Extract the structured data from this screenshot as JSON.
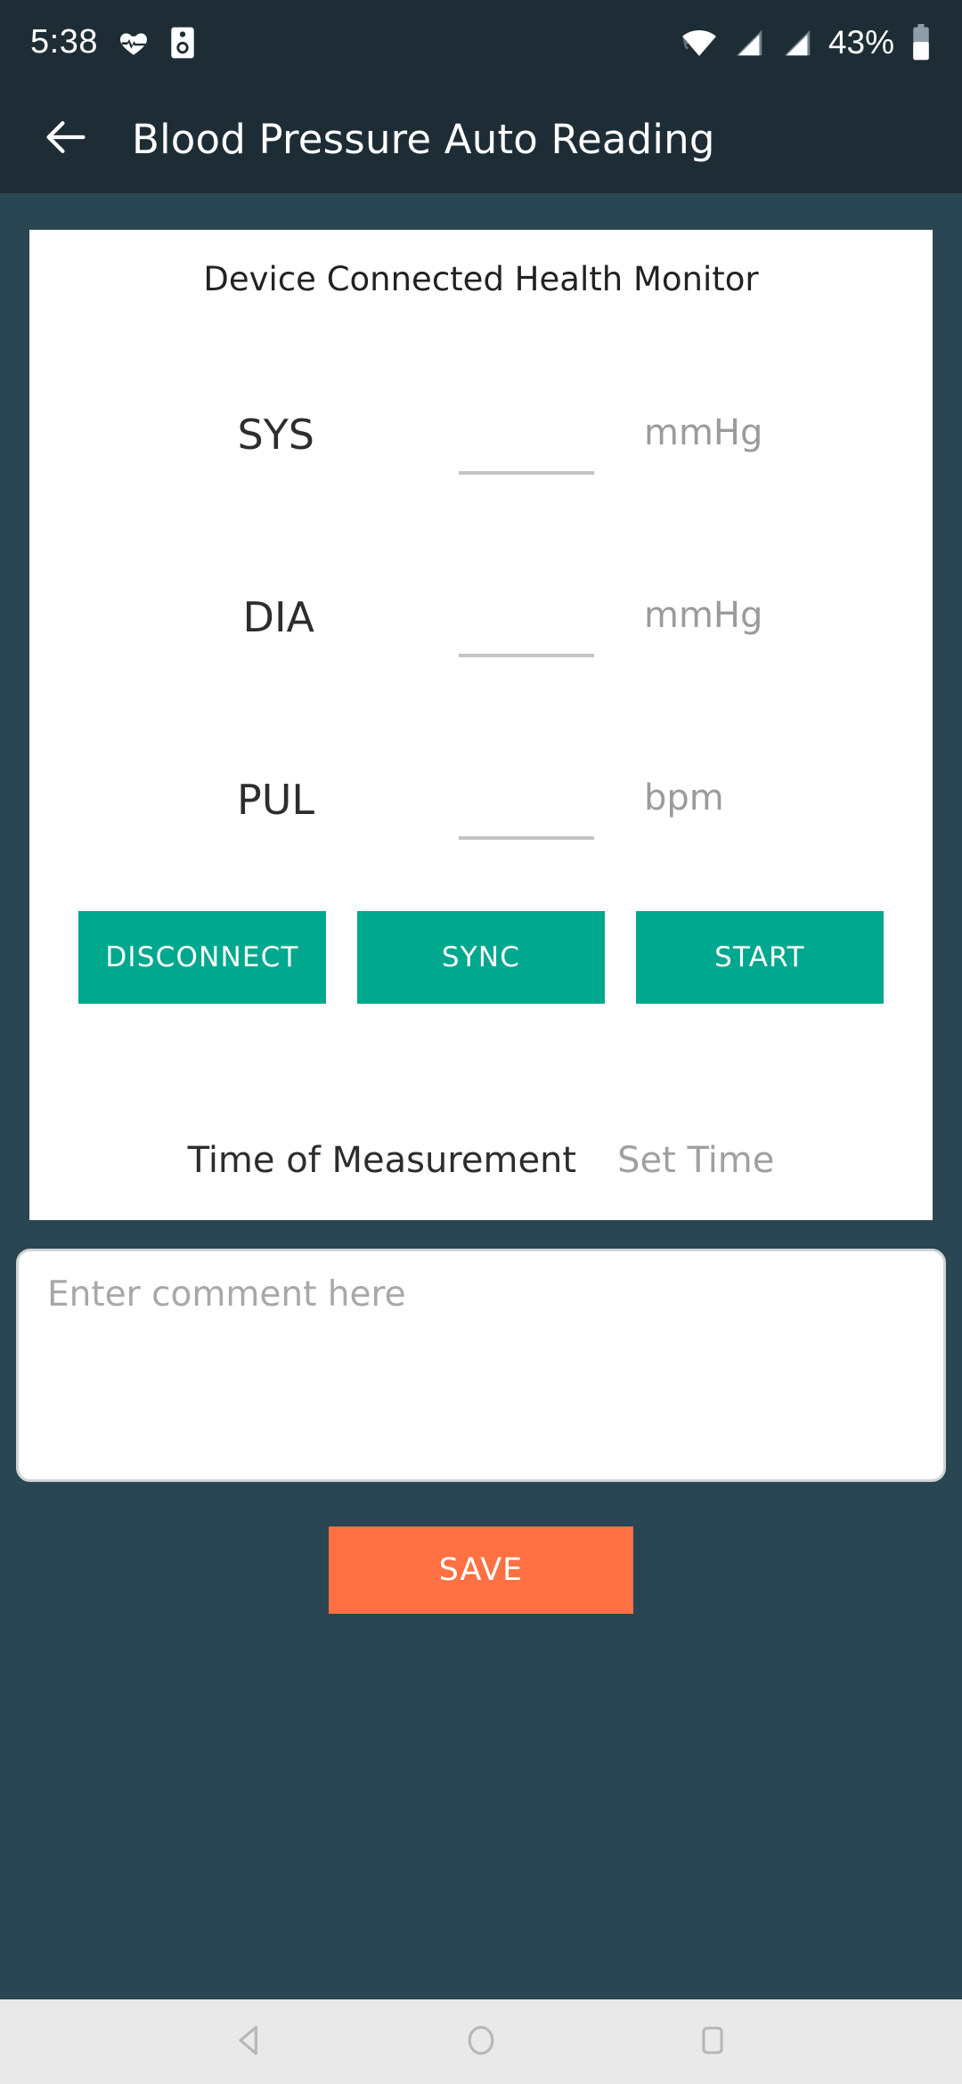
{
  "status_bar": {
    "clock": "5:38",
    "left_icons": [
      {
        "name": "heart-pulse-icon"
      },
      {
        "name": "speaker-device-icon"
      }
    ],
    "right_icons": [
      {
        "name": "wifi-icon"
      },
      {
        "name": "signal-bars-icon-1"
      },
      {
        "name": "signal-bars-icon-2"
      }
    ],
    "battery_percent": "43%",
    "battery_icon": "battery-icon"
  },
  "app_bar": {
    "back_icon": "back-arrow-icon",
    "title": "Blood Pressure Auto Reading"
  },
  "card": {
    "header": "Device Connected Health Monitor",
    "measurements": [
      {
        "label": "SYS",
        "value": "",
        "placeholder": "",
        "unit": "mmHg"
      },
      {
        "label": "DIA",
        "value": "",
        "placeholder": "",
        "unit": "mmHg"
      },
      {
        "label": "PUL",
        "value": "",
        "placeholder": "",
        "unit": "bpm"
      }
    ],
    "buttons": [
      {
        "label": "DISCONNECT"
      },
      {
        "label": "SYNC"
      },
      {
        "label": "START"
      }
    ],
    "time_row": {
      "label": "Time of Measurement",
      "value": "Set Time"
    }
  },
  "comment": {
    "value": "",
    "placeholder": "Enter comment here"
  },
  "save": {
    "label": "SAVE"
  },
  "nav_bar": {
    "back": "nav-back-icon",
    "home": "nav-home-icon",
    "recents": "nav-recents-icon"
  },
  "colors": {
    "app_bar": "#1e2d35",
    "background": "#2a4652",
    "card": "#ffffff",
    "accent_teal": "#00a88e",
    "accent_orange": "#ff7043",
    "nav_bar": "#e9e9e9"
  }
}
